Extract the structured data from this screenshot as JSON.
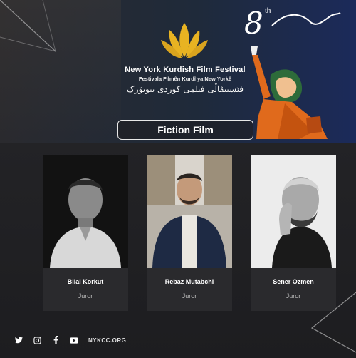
{
  "festival": {
    "title": "New York Kurdish Film Festival",
    "subtitle": "Festivala Filmên Kurdî ya New Yorkê",
    "title_kurdish": "فێستیڤاڵی فیلمی کوردی نیویۆرک",
    "edition_number": "8",
    "edition_suffix": "th"
  },
  "category": {
    "label": "Fiction Film"
  },
  "jurors": [
    {
      "name": "Bilal Korkut",
      "role": "Juror"
    },
    {
      "name": "Rebaz Mutabchi",
      "role": "Juror"
    },
    {
      "name": "Sener Ozmen",
      "role": "Juror"
    }
  ],
  "footer": {
    "icons": [
      "twitter-icon",
      "instagram-icon",
      "facebook-icon",
      "youtube-icon"
    ],
    "website": "NYKCC.ORG"
  },
  "colors": {
    "lotus_gold": "#e8b322",
    "statue_orange": "#e06a1c",
    "background_dark": "#1f1f22",
    "accent_navy": "#1b2a5a"
  }
}
